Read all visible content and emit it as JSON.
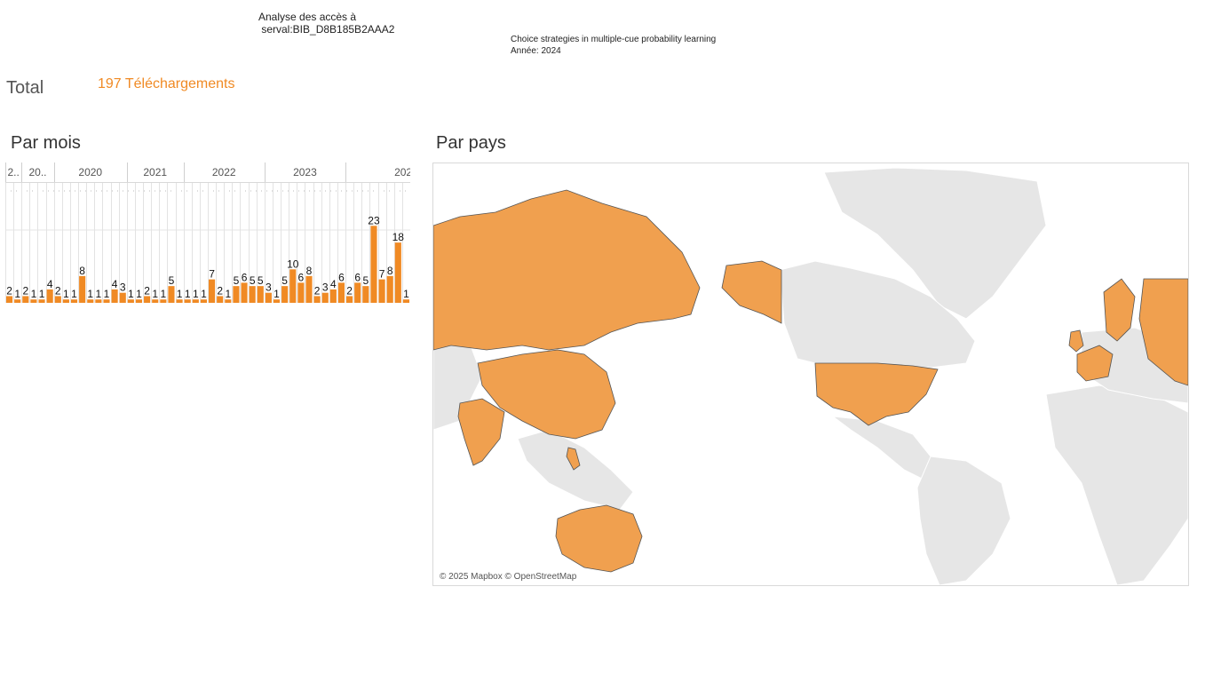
{
  "header": {
    "title_line1": "Analyse des accès à",
    "title_line2": " serval:BIB_D8B185B2AAA2",
    "publication_title": "Choice strategies in multiple-cue probability learning",
    "publication_year": "Année: 2024"
  },
  "total": {
    "label": "Total",
    "value": "197 Téléchargements"
  },
  "sections": {
    "monthly": "Par mois",
    "countries": "Par pays"
  },
  "map": {
    "attribution": "© 2025 Mapbox © OpenStreetMap",
    "highlight_color": "#f0a04f",
    "base_color": "#e6e6e6",
    "highlighted_countries": [
      "Russia",
      "China",
      "India",
      "United States",
      "Australia",
      "United Kingdom",
      "France",
      "Germany",
      "Belgium",
      "Netherlands",
      "Switzerland",
      "Sweden",
      "Norway",
      "Finland",
      "Philippines",
      "Cuba",
      "Iceland"
    ]
  },
  "chart_data": {
    "type": "bar",
    "title": "Par mois",
    "bar_color": "#f08a24",
    "groups": [
      {
        "label": "2..",
        "count": 2
      },
      {
        "label": "20..",
        "count": 4
      },
      {
        "label": "2020",
        "count": 9
      },
      {
        "label": "2021",
        "count": 7
      },
      {
        "label": "2022",
        "count": 10
      },
      {
        "label": "2023",
        "count": 10
      },
      {
        "label": "2024",
        "count": 15
      },
      {
        "label": "2025",
        "count": 6
      }
    ],
    "values": [
      2,
      1,
      2,
      1,
      1,
      4,
      2,
      1,
      1,
      8,
      1,
      1,
      1,
      4,
      3,
      1,
      1,
      2,
      1,
      1,
      5,
      1,
      1,
      1,
      1,
      7,
      2,
      1,
      5,
      6,
      5,
      5,
      3,
      1,
      5,
      10,
      6,
      8,
      2,
      3,
      4,
      6,
      2,
      6,
      5,
      23,
      7,
      8,
      18,
      1
    ],
    "labels": [
      "2",
      "1",
      "2",
      "1",
      "1",
      "4",
      "2",
      "1",
      "1",
      "8",
      "1",
      "1",
      "1",
      "4",
      "3",
      "1",
      "1",
      "2",
      "1",
      "1",
      "5",
      "1",
      "1",
      "1",
      "1",
      "7",
      "2",
      "1",
      "5",
      "6",
      "5",
      "5",
      "3",
      "1",
      "5",
      "10",
      "6",
      "8",
      "2",
      "3",
      "4",
      "6",
      "2",
      "6",
      "5",
      "23",
      "7",
      "8",
      "18",
      "1"
    ],
    "ylim": [
      0,
      26
    ],
    "grid": true
  }
}
